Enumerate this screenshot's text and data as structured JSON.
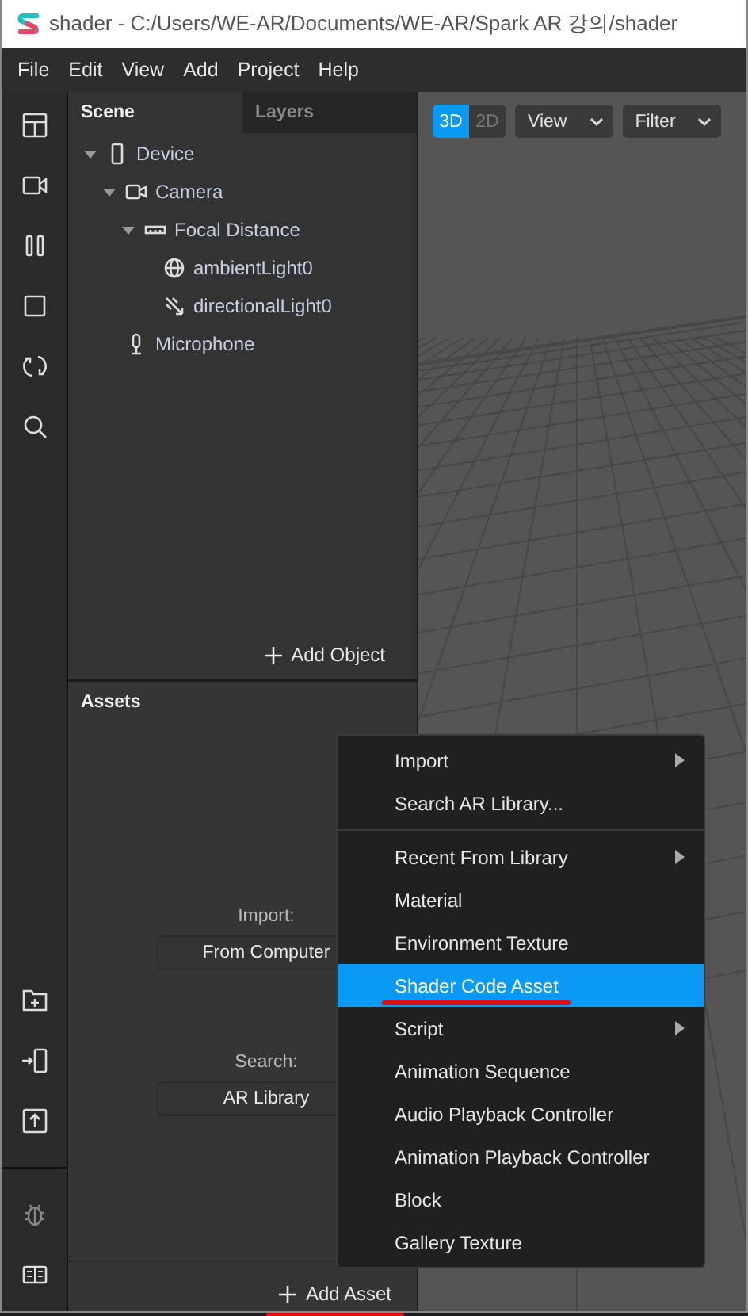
{
  "window": {
    "title": "shader - C:/Users/WE-AR/Documents/WE-AR/Spark AR 강의/shader"
  },
  "menu_bar": [
    "File",
    "Edit",
    "View",
    "Add",
    "Project",
    "Help"
  ],
  "scene_panel": {
    "tabs": [
      {
        "label": "Scene",
        "selected": true
      },
      {
        "label": "Layers",
        "selected": false
      }
    ],
    "tree": [
      {
        "label": "Device",
        "kind": "device",
        "expanded": true,
        "children": [
          {
            "label": "Camera",
            "kind": "camera",
            "expanded": true,
            "children": [
              {
                "label": "Focal Distance",
                "kind": "ruler",
                "expanded": true,
                "children": [
                  {
                    "label": "ambientLight0",
                    "kind": "globe"
                  },
                  {
                    "label": "directionalLight0",
                    "kind": "light"
                  }
                ]
              }
            ]
          },
          {
            "label": "Microphone",
            "kind": "microphone"
          }
        ]
      }
    ],
    "add_button": "Add Object"
  },
  "assets_panel": {
    "title": "Assets",
    "import_label": "Import:",
    "import_button": "From Computer",
    "search_label": "Search:",
    "search_button": "AR Library",
    "add_button": {
      "label": "Add Asset",
      "underlined": true
    }
  },
  "viewport": {
    "modes": [
      {
        "label": "3D",
        "selected": true
      },
      {
        "label": "2D",
        "selected": false
      }
    ],
    "dropdowns": [
      "View",
      "Filter"
    ]
  },
  "context_menu": [
    {
      "label": "Import",
      "submenu": true,
      "selected": false
    },
    {
      "label": "Search AR Library...",
      "submenu": false,
      "selected": false
    },
    {
      "label": "Recent From Library",
      "submenu": true,
      "selected": false,
      "separator_before": true
    },
    {
      "label": "Material",
      "submenu": false,
      "selected": false
    },
    {
      "label": "Environment Texture",
      "submenu": false,
      "selected": false
    },
    {
      "label": "Shader Code Asset",
      "submenu": false,
      "selected": true,
      "underlined": true
    },
    {
      "label": "Script",
      "submenu": true,
      "selected": false
    },
    {
      "label": "Animation Sequence",
      "submenu": false,
      "selected": false
    },
    {
      "label": "Audio Playback Controller",
      "submenu": false,
      "selected": false
    },
    {
      "label": "Animation Playback Controller",
      "submenu": false,
      "selected": false
    },
    {
      "label": "Block",
      "submenu": false,
      "selected": false
    },
    {
      "label": "Gallery Texture",
      "submenu": false,
      "selected": false
    }
  ]
}
